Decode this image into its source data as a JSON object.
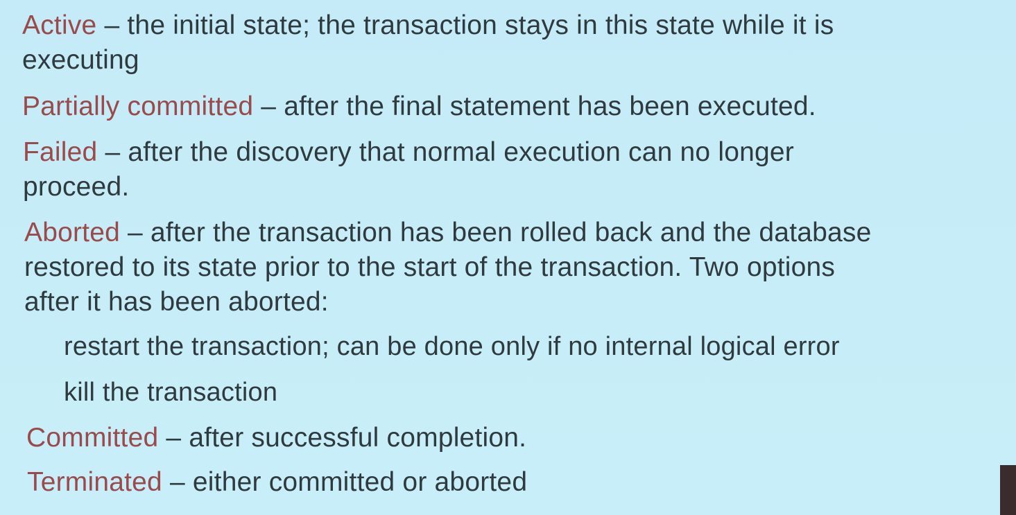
{
  "items": [
    {
      "term": "Active",
      "separator": "–",
      "lines": [
        "the initial state; the transaction stays in this state while it is",
        "executing"
      ]
    },
    {
      "term": "Partially committed",
      "separator": "–",
      "lines": [
        "after the final statement has been executed."
      ]
    },
    {
      "term": "Failed",
      "separator": "–",
      "lines": [
        "after the discovery that normal execution can no longer",
        "proceed."
      ]
    },
    {
      "term": "Aborted",
      "separator": "–",
      "lines": [
        "after the transaction has been rolled back and the database",
        "restored to its state prior to the start of the transaction.  Two options",
        "after it has been aborted:"
      ]
    },
    {
      "term": "Committed",
      "separator": "–",
      "lines": [
        "after successful completion."
      ]
    },
    {
      "term": "Terminated",
      "separator": "–",
      "lines": [
        "either committed or aborted"
      ]
    }
  ],
  "aborted_options": [
    "restart the transaction; can be done only if no internal logical error",
    "kill the transaction"
  ],
  "colors": {
    "background": "#c6ecf7",
    "term": "#9a4a4a",
    "text": "#2f3a3f"
  }
}
